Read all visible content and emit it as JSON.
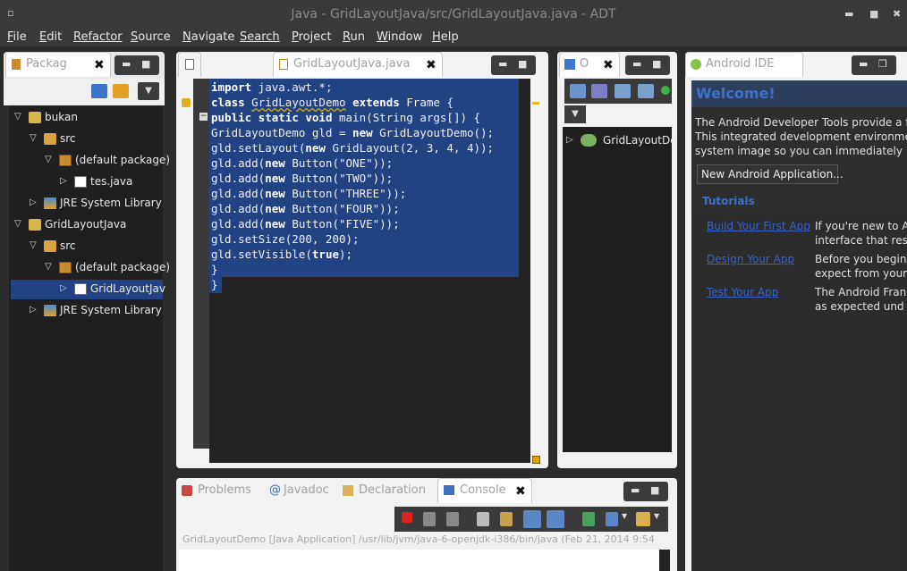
{
  "window": {
    "title": "Java - GridLayoutJava/src/GridLayoutJava.java - ADT",
    "menu_glyph": "▫",
    "min": "▬",
    "max": "■",
    "close": "✖"
  },
  "menu": [
    {
      "label": "File",
      "u": "F",
      "rest": "ile"
    },
    {
      "label": "Edit",
      "u": "E",
      "rest": "dit"
    },
    {
      "label": "Refactor",
      "u": "",
      "rest": "Refactor"
    },
    {
      "label": "Source",
      "u": "S",
      "rest": "ource"
    },
    {
      "label": "Navigate",
      "u": "N",
      "rest": "avigate"
    },
    {
      "label": "Search",
      "u": "",
      "rest": "Search"
    },
    {
      "label": "Project",
      "u": "P",
      "rest": "roject"
    },
    {
      "label": "Run",
      "u": "R",
      "rest": "un"
    },
    {
      "label": "Window",
      "u": "W",
      "rest": "indow"
    },
    {
      "label": "Help",
      "u": "H",
      "rest": "elp"
    }
  ],
  "package_explorer": {
    "tab_label": "Packag",
    "tree": [
      {
        "label": "bukan",
        "indent": 0,
        "icon": "proj"
      },
      {
        "label": "src",
        "indent": 1,
        "icon": "folder"
      },
      {
        "label": "(default package)",
        "indent": 2,
        "icon": "pkg"
      },
      {
        "label": "tes.java",
        "indent": 3,
        "icon": "java"
      },
      {
        "label": "JRE System Library",
        "indent": 1,
        "icon": "jre"
      },
      {
        "label": "GridLayoutJava",
        "indent": 0,
        "icon": "proj"
      },
      {
        "label": "src",
        "indent": 1,
        "icon": "folder"
      },
      {
        "label": "(default package)",
        "indent": 2,
        "icon": "pkg"
      },
      {
        "label": "GridLayoutJav",
        "indent": 3,
        "icon": "java",
        "selected": true
      },
      {
        "label": "JRE System Library",
        "indent": 1,
        "icon": "jre"
      }
    ]
  },
  "editor": {
    "active_tab": "GridLayoutJava.java",
    "code": [
      [
        {
          "t": "import",
          "k": 1
        },
        {
          "t": " java.awt.*;"
        }
      ],
      [
        {
          "t": "class",
          "k": 1
        },
        {
          "t": " "
        },
        {
          "t": "GridLayoutDemo",
          "u": 1
        },
        {
          "t": " "
        },
        {
          "t": "extends",
          "k": 1
        },
        {
          "t": " Frame {"
        }
      ],
      [
        {
          "t": "public",
          "k": 1
        },
        {
          "t": " "
        },
        {
          "t": "static",
          "k": 1
        },
        {
          "t": " "
        },
        {
          "t": "void",
          "k": 1
        },
        {
          "t": " main(String args[]) {"
        }
      ],
      [
        {
          "t": "GridLayoutDemo gld = "
        },
        {
          "t": "new",
          "k": 1
        },
        {
          "t": " GridLayoutDemo();"
        }
      ],
      [
        {
          "t": "gld.setLayout("
        },
        {
          "t": "new",
          "k": 1
        },
        {
          "t": " GridLayout(2, 3, 4, 4));"
        }
      ],
      [
        {
          "t": "gld.add("
        },
        {
          "t": "new",
          "k": 1
        },
        {
          "t": " Button(\"ONE\"));"
        }
      ],
      [
        {
          "t": "gld.add("
        },
        {
          "t": "new",
          "k": 1
        },
        {
          "t": " Button(\"TWO\"));"
        }
      ],
      [
        {
          "t": "gld.add("
        },
        {
          "t": "new",
          "k": 1
        },
        {
          "t": " Button(\"THREE\"));"
        }
      ],
      [
        {
          "t": "gld.add("
        },
        {
          "t": "new",
          "k": 1
        },
        {
          "t": " Button(\"FOUR\"));"
        }
      ],
      [
        {
          "t": "gld.add("
        },
        {
          "t": "new",
          "k": 1
        },
        {
          "t": " Button(\"FIVE\"));"
        }
      ],
      [
        {
          "t": "gld.setSize(200, 200);"
        }
      ],
      [
        {
          "t": "gld.setVisible("
        },
        {
          "t": "true",
          "k": 1
        },
        {
          "t": ");"
        }
      ],
      [
        {
          "t": "}"
        }
      ],
      [
        {
          "t": "}"
        }
      ]
    ]
  },
  "outline": {
    "tab_label": "O",
    "tree_item": "GridLayoutDe"
  },
  "android": {
    "tab_label": "Android IDE",
    "welcome_title": "Welcome!",
    "intro_lines": [
      "The Android Developer Tools provide a fi",
      "This integrated development environmen",
      "system image so you can immediately"
    ],
    "new_app_button": "New Android Application...",
    "tutorials_heading": "Tutorials",
    "tutorials": [
      {
        "link": "Build Your First App",
        "desc": [
          "If you're new to A",
          "interface that res"
        ]
      },
      {
        "link": "Design Your App",
        "desc": [
          "Before you begin",
          "expect from your"
        ]
      },
      {
        "link": "Test Your App",
        "desc": [
          "The Android Fran",
          "as expected und"
        ]
      }
    ]
  },
  "console": {
    "tabs": [
      "Problems",
      "Javadoc",
      "Declaration",
      "Console"
    ],
    "active_tab": "Console",
    "status": "GridLayoutDemo [Java Application] /usr/lib/jvm/java-6-openjdk-i386/bin/java (Feb 21, 2014 9:54"
  }
}
